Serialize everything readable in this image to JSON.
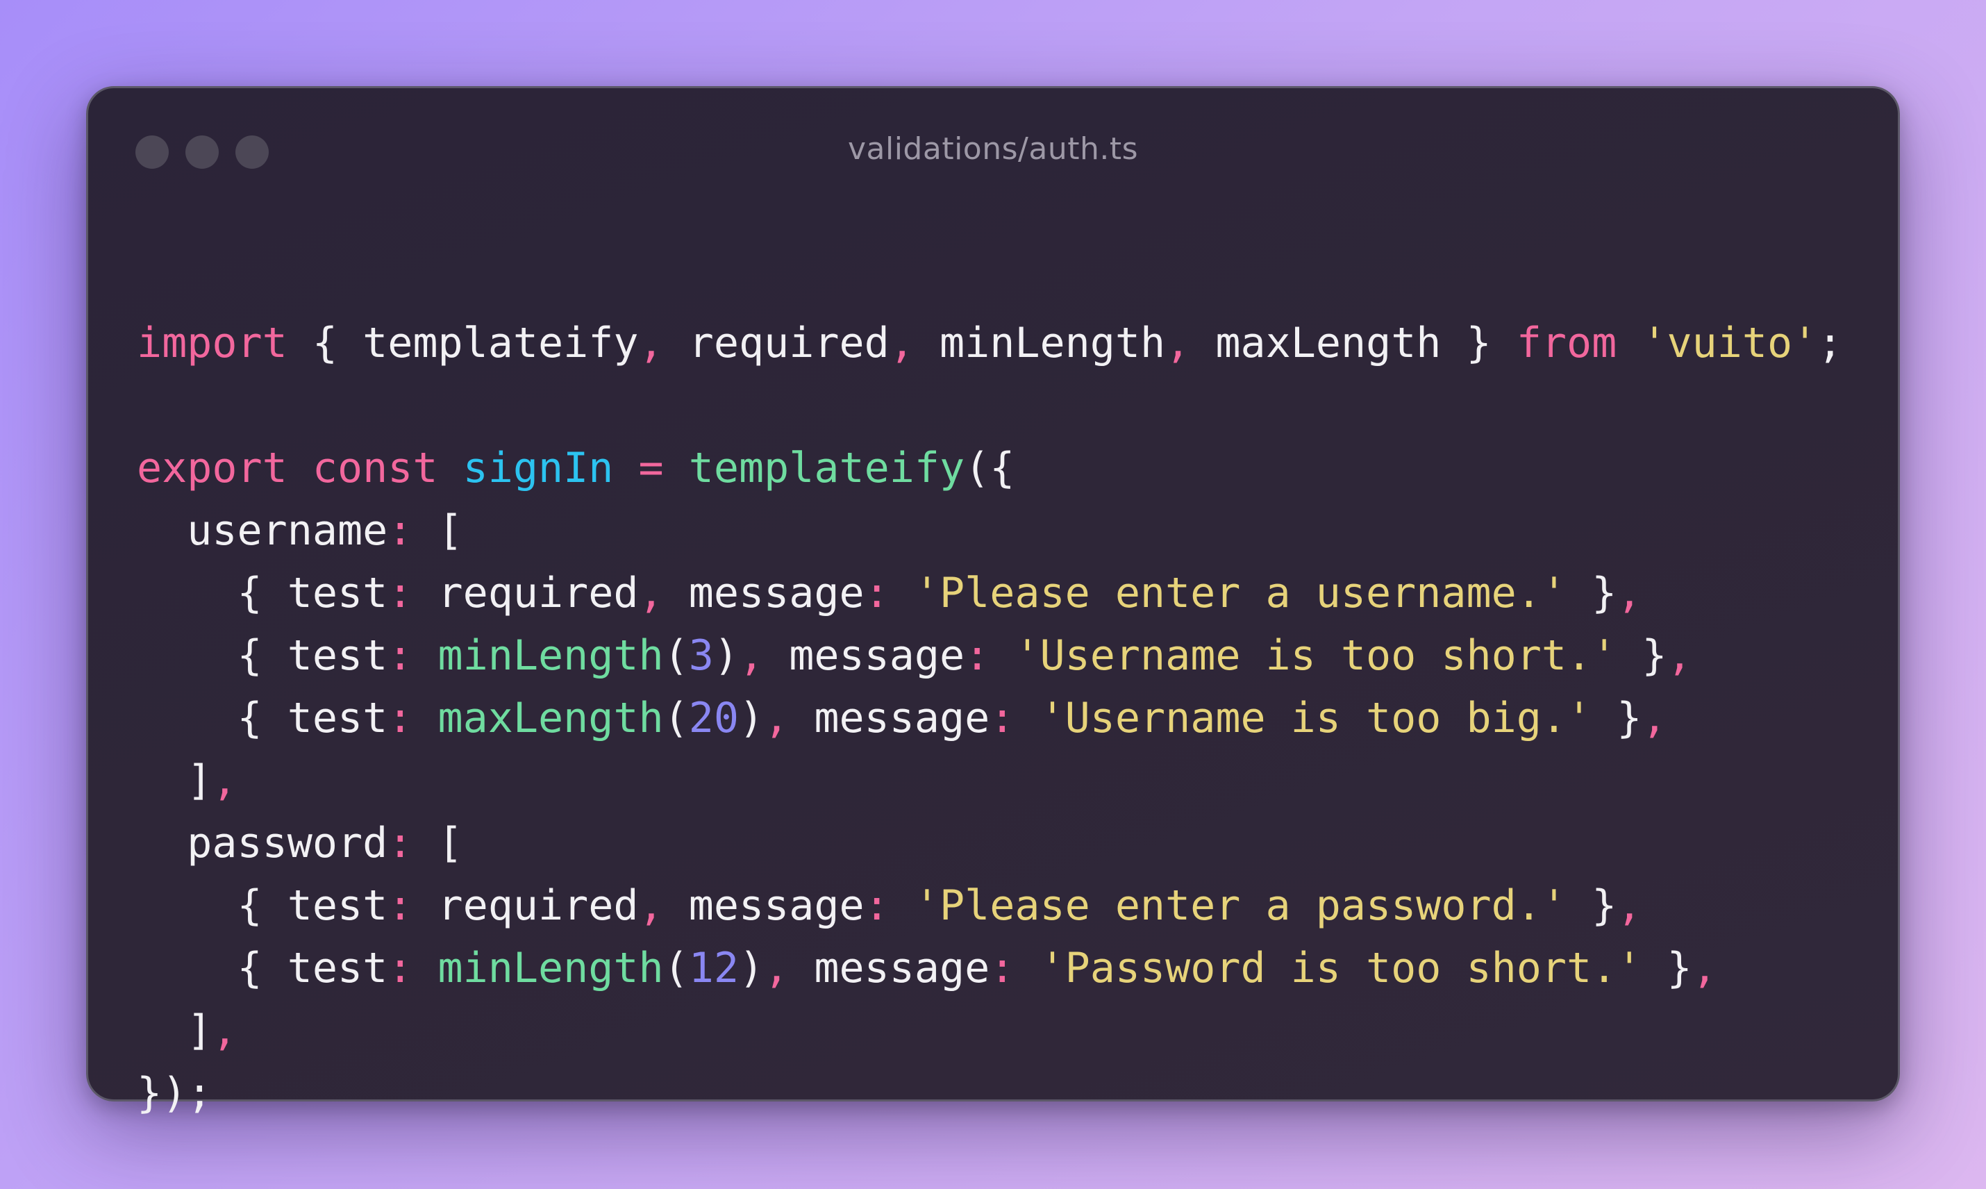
{
  "window": {
    "title": "validations/auth.ts",
    "traffic_lights": [
      "close",
      "minimize",
      "maximize"
    ]
  },
  "colors": {
    "keyword": "#f2679d",
    "function": "#6fdca0",
    "variable": "#2cc3f0",
    "string": "#e7d37a",
    "number": "#8a87f2",
    "text": "#f2f1f4"
  },
  "code": {
    "lines": [
      [
        {
          "t": "import",
          "k": "kw"
        },
        {
          "t": " { templateify",
          "k": "plain"
        },
        {
          "t": ",",
          "k": "punct"
        },
        {
          "t": " required",
          "k": "plain"
        },
        {
          "t": ",",
          "k": "punct"
        },
        {
          "t": " minLength",
          "k": "plain"
        },
        {
          "t": ",",
          "k": "punct"
        },
        {
          "t": " maxLength } ",
          "k": "plain"
        },
        {
          "t": "from",
          "k": "kw"
        },
        {
          "t": " ",
          "k": "plain"
        },
        {
          "t": "'vuito'",
          "k": "str"
        },
        {
          "t": ";",
          "k": "plain"
        }
      ],
      [],
      [
        {
          "t": "export",
          "k": "kw"
        },
        {
          "t": " ",
          "k": "plain"
        },
        {
          "t": "const",
          "k": "kw"
        },
        {
          "t": " ",
          "k": "plain"
        },
        {
          "t": "signIn",
          "k": "var"
        },
        {
          "t": " ",
          "k": "plain"
        },
        {
          "t": "=",
          "k": "punct"
        },
        {
          "t": " ",
          "k": "plain"
        },
        {
          "t": "templateify",
          "k": "fn"
        },
        {
          "t": "({",
          "k": "plain"
        }
      ],
      [
        {
          "t": "  username",
          "k": "plain"
        },
        {
          "t": ":",
          "k": "punct"
        },
        {
          "t": " [",
          "k": "plain"
        }
      ],
      [
        {
          "t": "    { test",
          "k": "plain"
        },
        {
          "t": ":",
          "k": "punct"
        },
        {
          "t": " required",
          "k": "plain"
        },
        {
          "t": ",",
          "k": "punct"
        },
        {
          "t": " message",
          "k": "plain"
        },
        {
          "t": ":",
          "k": "punct"
        },
        {
          "t": " ",
          "k": "plain"
        },
        {
          "t": "'Please enter a username.'",
          "k": "str"
        },
        {
          "t": " }",
          "k": "plain"
        },
        {
          "t": ",",
          "k": "punct"
        }
      ],
      [
        {
          "t": "    { test",
          "k": "plain"
        },
        {
          "t": ":",
          "k": "punct"
        },
        {
          "t": " ",
          "k": "plain"
        },
        {
          "t": "minLength",
          "k": "fn"
        },
        {
          "t": "(",
          "k": "plain"
        },
        {
          "t": "3",
          "k": "num"
        },
        {
          "t": ")",
          "k": "plain"
        },
        {
          "t": ",",
          "k": "punct"
        },
        {
          "t": " message",
          "k": "plain"
        },
        {
          "t": ":",
          "k": "punct"
        },
        {
          "t": " ",
          "k": "plain"
        },
        {
          "t": "'Username is too short.'",
          "k": "str"
        },
        {
          "t": " }",
          "k": "plain"
        },
        {
          "t": ",",
          "k": "punct"
        }
      ],
      [
        {
          "t": "    { test",
          "k": "plain"
        },
        {
          "t": ":",
          "k": "punct"
        },
        {
          "t": " ",
          "k": "plain"
        },
        {
          "t": "maxLength",
          "k": "fn"
        },
        {
          "t": "(",
          "k": "plain"
        },
        {
          "t": "20",
          "k": "num"
        },
        {
          "t": ")",
          "k": "plain"
        },
        {
          "t": ",",
          "k": "punct"
        },
        {
          "t": " message",
          "k": "plain"
        },
        {
          "t": ":",
          "k": "punct"
        },
        {
          "t": " ",
          "k": "plain"
        },
        {
          "t": "'Username is too big.'",
          "k": "str"
        },
        {
          "t": " }",
          "k": "plain"
        },
        {
          "t": ",",
          "k": "punct"
        }
      ],
      [
        {
          "t": "  ]",
          "k": "plain"
        },
        {
          "t": ",",
          "k": "punct"
        }
      ],
      [
        {
          "t": "  password",
          "k": "plain"
        },
        {
          "t": ":",
          "k": "punct"
        },
        {
          "t": " [",
          "k": "plain"
        }
      ],
      [
        {
          "t": "    { test",
          "k": "plain"
        },
        {
          "t": ":",
          "k": "punct"
        },
        {
          "t": " required",
          "k": "plain"
        },
        {
          "t": ",",
          "k": "punct"
        },
        {
          "t": " message",
          "k": "plain"
        },
        {
          "t": ":",
          "k": "punct"
        },
        {
          "t": " ",
          "k": "plain"
        },
        {
          "t": "'Please enter a password.'",
          "k": "str"
        },
        {
          "t": " }",
          "k": "plain"
        },
        {
          "t": ",",
          "k": "punct"
        }
      ],
      [
        {
          "t": "    { test",
          "k": "plain"
        },
        {
          "t": ":",
          "k": "punct"
        },
        {
          "t": " ",
          "k": "plain"
        },
        {
          "t": "minLength",
          "k": "fn"
        },
        {
          "t": "(",
          "k": "plain"
        },
        {
          "t": "12",
          "k": "num"
        },
        {
          "t": ")",
          "k": "plain"
        },
        {
          "t": ",",
          "k": "punct"
        },
        {
          "t": " message",
          "k": "plain"
        },
        {
          "t": ":",
          "k": "punct"
        },
        {
          "t": " ",
          "k": "plain"
        },
        {
          "t": "'Password is too short.'",
          "k": "str"
        },
        {
          "t": " }",
          "k": "plain"
        },
        {
          "t": ",",
          "k": "punct"
        }
      ],
      [
        {
          "t": "  ]",
          "k": "plain"
        },
        {
          "t": ",",
          "k": "punct"
        }
      ],
      [
        {
          "t": "});",
          "k": "plain"
        }
      ]
    ]
  }
}
